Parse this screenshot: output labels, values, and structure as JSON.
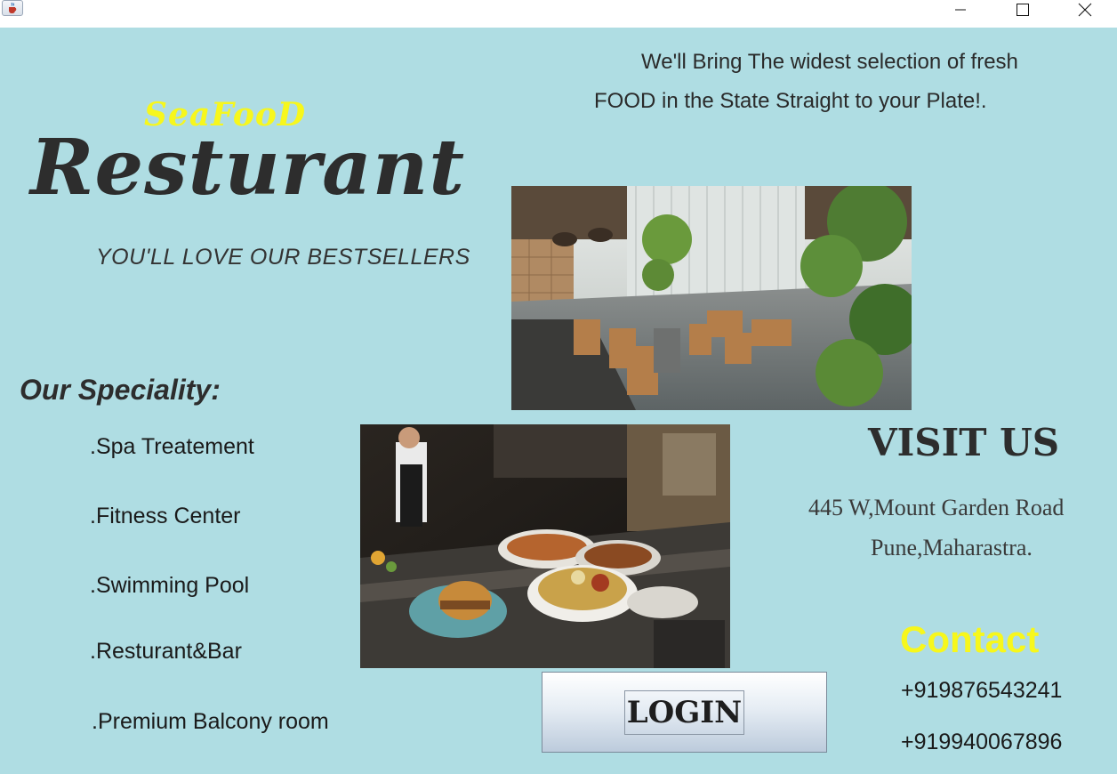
{
  "titlebar": {
    "app_icon": "java-cup-icon",
    "controls": [
      "minimize-icon",
      "maximize-icon",
      "close-icon"
    ]
  },
  "tagline": {
    "line1": "We'll Bring The widest selection of fresh",
    "line2": "FOOD in the State Straight to your Plate!."
  },
  "brand": {
    "small": "SeaFooD",
    "big": "Resturant",
    "subtitle": "YOU'LL LOVE OUR BESTSELLERS"
  },
  "speciality": {
    "title": "Our Speciality:",
    "items": [
      ".Spa Treatement",
      ".Fitness Center",
      ".Swimming Pool",
      ".Resturant&Bar",
      ".Premium Balcony room"
    ]
  },
  "visit": {
    "title": "VISIT US",
    "address_line1": "445 W,Mount Garden Road",
    "address_line2": "Pune,Maharastra."
  },
  "contact": {
    "title": "Contact",
    "phone1": "+919876543241",
    "phone2": "+919940067896"
  },
  "login_label": "LOGIN",
  "colors": {
    "background": "#afdde3",
    "accent_yellow": "#f7f71c",
    "text_dark": "#2d2d2d"
  }
}
